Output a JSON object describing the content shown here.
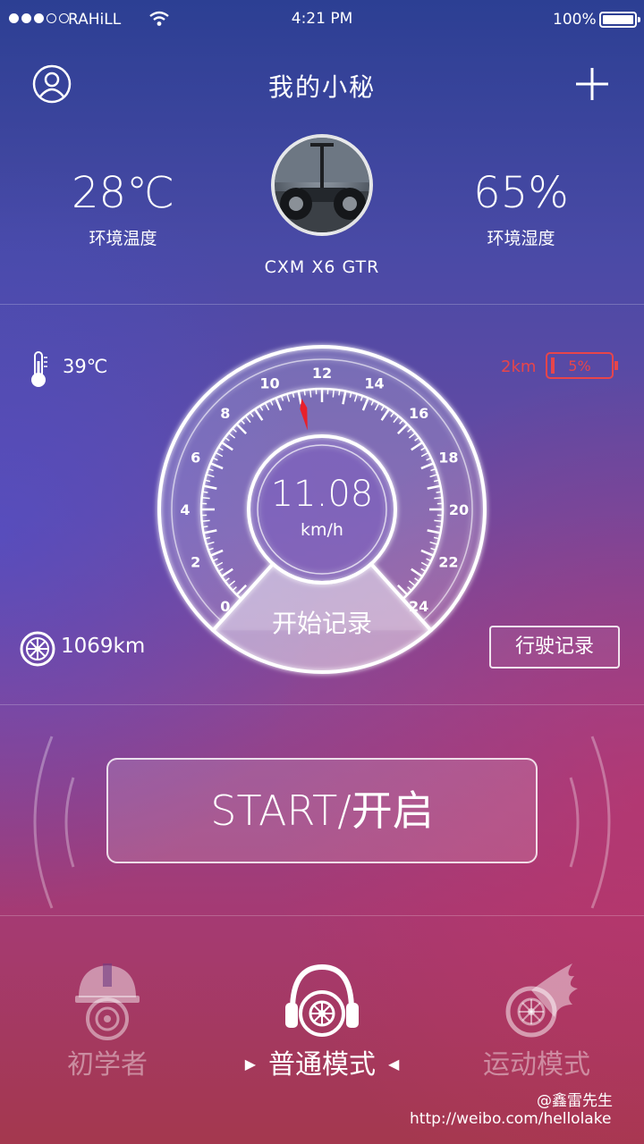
{
  "status_bar": {
    "carrier": "RAHiLL",
    "time": "4:21 PM",
    "battery_percent": "100%",
    "signal_bars": 3,
    "signal_total": 5
  },
  "header": {
    "title": "我的小秘",
    "profile_icon": "user-icon",
    "add_icon": "plus-icon"
  },
  "environment": {
    "temperature": "28℃",
    "temperature_label": "环境温度",
    "humidity": "65%",
    "humidity_label": "环境湿度"
  },
  "vehicle": {
    "model": "CXM X6 GTR"
  },
  "telemetry": {
    "chip_temperature": "39℃",
    "remaining_range": "2km",
    "battery_level": "5%",
    "odometer": "1069km"
  },
  "speedometer": {
    "speed": "11.08",
    "unit": "km/h",
    "scale_labels": [
      "0",
      "2",
      "4",
      "6",
      "8",
      "10",
      "12",
      "14",
      "16",
      "18",
      "20",
      "22",
      "24"
    ],
    "scale_max": 24,
    "record_label": "开始记录"
  },
  "actions": {
    "trip_log_label": "行驶记录",
    "start_label": "START/开启"
  },
  "modes": [
    {
      "label": "初学者",
      "icon": "helmet-icon",
      "active": false
    },
    {
      "label": "普通模式",
      "icon": "headphones-wheel-icon",
      "active": true
    },
    {
      "label": "运动模式",
      "icon": "flaming-wheel-icon",
      "active": false
    }
  ],
  "watermark": {
    "author": "@鑫雷先生",
    "url": "http://weibo.com/hellolake"
  },
  "colors": {
    "alert": "#e8454a",
    "needle": "#e8202a"
  }
}
